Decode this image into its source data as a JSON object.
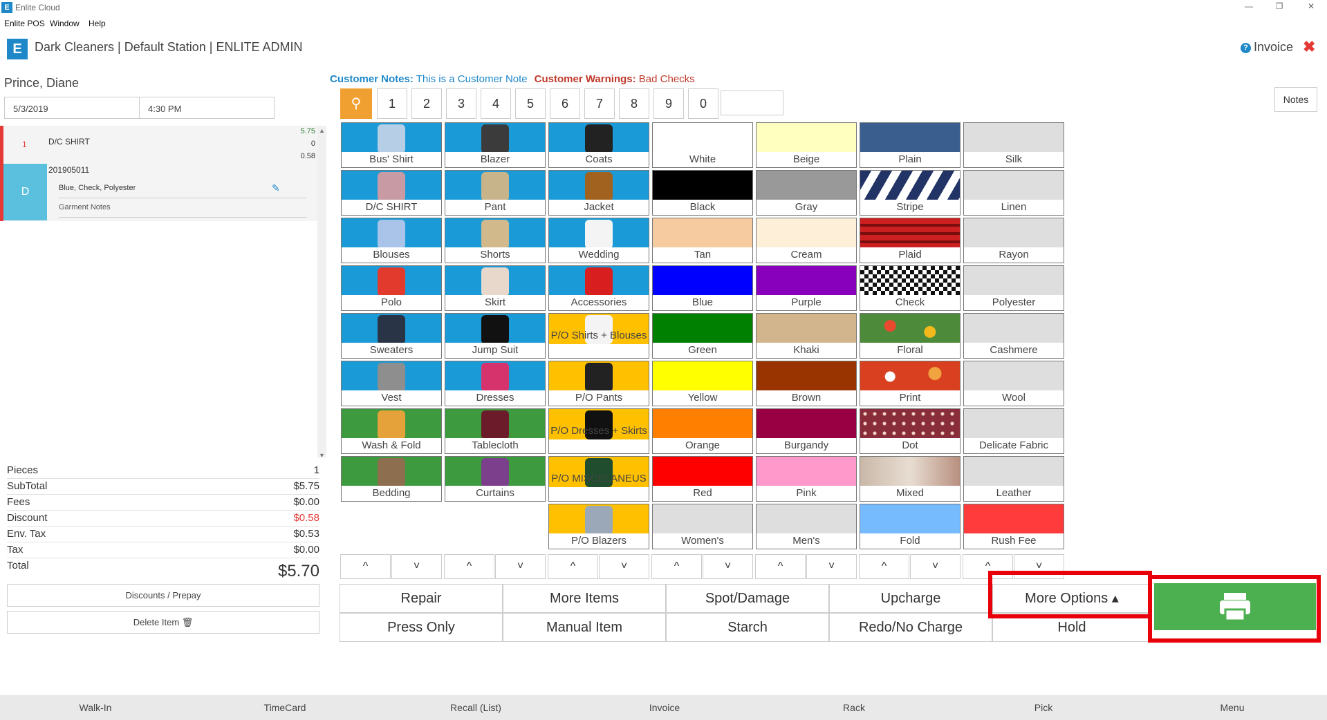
{
  "window": {
    "title": "Enlite Cloud",
    "menu": [
      "Enlite POS",
      "Window",
      "Help"
    ]
  },
  "header": {
    "title": "Dark Cleaners | Default Station | ENLITE ADMIN",
    "invoice_label": "Invoice"
  },
  "customer": {
    "name": "Prince, Diane",
    "date": "5/3/2019",
    "time": "4:30 PM"
  },
  "ticket": {
    "qty": "1",
    "item": "D/C SHIRT",
    "price": "5.75",
    "v2": "0",
    "v3": "0.58",
    "tag": "201905011",
    "badge": "D",
    "details": "Blue, Check, Polyester",
    "garment_notes": "Garment Notes"
  },
  "summary": [
    {
      "label": "Pieces",
      "value": "1"
    },
    {
      "label": "SubTotal",
      "value": "$5.75"
    },
    {
      "label": "Fees",
      "value": "$0.00"
    },
    {
      "label": "Discount",
      "value": "$0.58"
    },
    {
      "label": "Env. Tax",
      "value": "$0.53"
    },
    {
      "label": "Tax",
      "value": "$0.00"
    }
  ],
  "total": {
    "label": "Total",
    "value": "$5.70"
  },
  "left_buttons": {
    "discounts": "Discounts / Prepay",
    "delete": "Delete Item 🗑"
  },
  "notes": {
    "customer_notes_label": "Customer Notes:",
    "customer_notes": "This is a Customer Note",
    "warnings_label": "Customer Warnings:",
    "warnings": "Bad Checks",
    "notes_button": "Notes"
  },
  "numpad": [
    "1",
    "2",
    "3",
    "4",
    "5",
    "6",
    "7",
    "8",
    "9",
    "0"
  ],
  "columns": {
    "garments_a": [
      {
        "label": "Bus' Shirt",
        "icon": "shirt-icon",
        "bg": "#1a9bd7",
        "pic": "#b7cfe6"
      },
      {
        "label": "D/C SHIRT",
        "icon": "shirt-icon",
        "bg": "#1a9bd7",
        "pic": "#c89aa4"
      },
      {
        "label": "Blouses",
        "icon": "blouse-icon",
        "bg": "#1a9bd7",
        "pic": "#a9c4e8"
      },
      {
        "label": "Polo",
        "icon": "polo-icon",
        "bg": "#1a9bd7",
        "pic": "#e23b2e"
      },
      {
        "label": "Sweaters",
        "icon": "sweater-icon",
        "bg": "#1a9bd7",
        "pic": "#2a3447"
      },
      {
        "label": "Vest",
        "icon": "vest-icon",
        "bg": "#1a9bd7",
        "pic": "#8e8e8e"
      },
      {
        "label": "Wash & Fold",
        "icon": "folded-clothes-icon",
        "bg": "#3d9a3f",
        "pic": "#e5a23a"
      },
      {
        "label": "Bedding",
        "icon": "bed-icon",
        "bg": "#3d9a3f",
        "pic": "#8d6e4f"
      }
    ],
    "garments_b": [
      {
        "label": "Blazer",
        "icon": "blazer-icon",
        "bg": "#1a9bd7",
        "pic": "#3b3b3b"
      },
      {
        "label": "Pant",
        "icon": "pants-icon",
        "bg": "#1a9bd7",
        "pic": "#c8b48a"
      },
      {
        "label": "Shorts",
        "icon": "shorts-icon",
        "bg": "#1a9bd7",
        "pic": "#d2b98c"
      },
      {
        "label": "Skirt",
        "icon": "skirt-icon",
        "bg": "#1a9bd7",
        "pic": "#e8d8cc"
      },
      {
        "label": "Jump Suit",
        "icon": "jumpsuit-icon",
        "bg": "#1a9bd7",
        "pic": "#111111"
      },
      {
        "label": "Dresses",
        "icon": "dress-icon",
        "bg": "#1a9bd7",
        "pic": "#d6336c"
      },
      {
        "label": "Tablecloth",
        "icon": "tablecloth-icon",
        "bg": "#3d9a3f",
        "pic": "#6b1b2a"
      },
      {
        "label": "Curtains",
        "icon": "curtains-icon",
        "bg": "#3d9a3f",
        "pic": "#7b3f8c"
      }
    ],
    "garments_c": [
      {
        "label": "Coats",
        "icon": "coat-icon",
        "bg": "#1a9bd7",
        "pic": "#222222"
      },
      {
        "label": "Jacket",
        "icon": "jacket-icon",
        "bg": "#1a9bd7",
        "pic": "#a0621e"
      },
      {
        "label": "Wedding",
        "icon": "wedding-dress-icon",
        "bg": "#1a9bd7",
        "pic": "#f4f4f4"
      },
      {
        "label": "Accessories",
        "icon": "scarf-icon",
        "bg": "#1a9bd7",
        "pic": "#d81e1e"
      },
      {
        "label": "P/O Shirts + Blouses",
        "icon": "shirt-icon",
        "bg": "#ffc000",
        "pic": "#f4f4f4"
      },
      {
        "label": "P/O Pants",
        "icon": "pants-icon",
        "bg": "#ffc000",
        "pic": "#222222"
      },
      {
        "label": "P/O Dresses + Skirts",
        "icon": "dress-icon",
        "bg": "#ffc000",
        "pic": "#111111"
      },
      {
        "label": "P/O MISCELANEUS",
        "icon": "misc-icon",
        "bg": "#ffc000",
        "pic": "#1f4d2e"
      },
      {
        "label": "P/O Blazers",
        "icon": "blazer-icon",
        "bg": "#ffc000",
        "pic": "#9aa8b8"
      }
    ],
    "colors_a": [
      {
        "label": "White",
        "swatch": "#ffffff"
      },
      {
        "label": "Black",
        "swatch": "#000000"
      },
      {
        "label": "Tan",
        "swatch": "#f6cba0"
      },
      {
        "label": "Blue",
        "swatch": "#0000ff"
      },
      {
        "label": "Green",
        "swatch": "#008000"
      },
      {
        "label": "Yellow",
        "swatch": "#ffff00"
      },
      {
        "label": "Orange",
        "swatch": "#ff8000"
      },
      {
        "label": "Red",
        "swatch": "#ff0000"
      },
      {
        "label": "Women's",
        "swatch": "#dedede"
      }
    ],
    "colors_b": [
      {
        "label": "Beige",
        "swatch": "#ffffc0"
      },
      {
        "label": "Gray",
        "swatch": "#999999"
      },
      {
        "label": "Cream",
        "swatch": "#fdefd8"
      },
      {
        "label": "Purple",
        "swatch": "#8800bb"
      },
      {
        "label": "Khaki",
        "swatch": "#d2b58c"
      },
      {
        "label": "Brown",
        "swatch": "#993300"
      },
      {
        "label": "Burgandy",
        "swatch": "#990044"
      },
      {
        "label": "Pink",
        "swatch": "#ff99cc"
      },
      {
        "label": "Men's",
        "swatch": "#dedede"
      }
    ],
    "patterns": [
      {
        "label": "Plain",
        "swatch": "#3a5f8f"
      },
      {
        "label": "Stripe",
        "swatch": "repeating-linear-gradient(120deg,#223366 0 14px,#ffffff 14px 26px)"
      },
      {
        "label": "Plaid",
        "swatch": "repeating-linear-gradient(0deg,#cc1f1f 0 8px,#7a0d0d 8px 12px),#cc1f1f"
      },
      {
        "label": "Check",
        "swatch": "repeating-conic-gradient(#111 0 25%,#fff 0 50%) 0 0/12px 12px"
      },
      {
        "label": "Floral",
        "swatch": "radial-gradient(circle at 30% 40%,#e84a2f 0 8px,transparent 9px),radial-gradient(circle at 70% 60%,#f2b81c 0 8px,transparent 9px),#4d8b3a"
      },
      {
        "label": "Print",
        "swatch": "radial-gradient(circle at 30% 50%,#ffffff 0 7px,transparent 8px),radial-gradient(circle at 75% 40%,#f1a340 0 9px,transparent 10px),#d8401f"
      },
      {
        "label": "Dot",
        "swatch": "radial-gradient(circle,#f5d6c8 0 2px,transparent 3px) 0 0/14px 14px,#8a2d3b"
      },
      {
        "label": "Mixed",
        "swatch": "linear-gradient(90deg,#c9b8a8,#e8ddd2,#b89080)"
      },
      {
        "label": "Fold",
        "swatch": "#77bbff"
      }
    ],
    "fabrics": [
      {
        "label": "Silk",
        "swatch": "#dedede"
      },
      {
        "label": "Linen",
        "swatch": "#dedede"
      },
      {
        "label": "Rayon",
        "swatch": "#dedede"
      },
      {
        "label": "Polyester",
        "swatch": "#dedede"
      },
      {
        "label": "Cashmere",
        "swatch": "#dedede"
      },
      {
        "label": "Wool",
        "swatch": "#dedede"
      },
      {
        "label": "Delicate Fabric",
        "swatch": "#dedede"
      },
      {
        "label": "Leather",
        "swatch": "#dedede"
      },
      {
        "label": "Rush Fee",
        "swatch": "#ff3b3b"
      }
    ]
  },
  "scroll_arrows": {
    "up": "^",
    "down": "˅"
  },
  "actions": {
    "row1": [
      "Repair",
      "More Items",
      "Spot/Damage",
      "Upcharge",
      "More Options ▴"
    ],
    "row2": [
      "Press Only",
      "Manual Item",
      "Starch",
      "Redo/No Charge",
      "Hold"
    ]
  },
  "bottom_nav": [
    "Walk-In",
    "TimeCard",
    "Recall (List)",
    "Invoice",
    "Rack",
    "Pick",
    "Menu"
  ]
}
